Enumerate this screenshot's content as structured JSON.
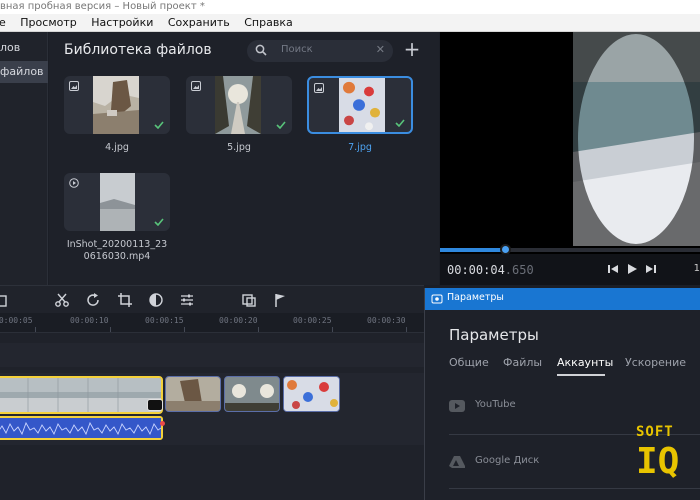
{
  "window": {
    "title": "вная пробная версия – Новый проект *"
  },
  "menu": {
    "items": [
      "е",
      "Просмотр",
      "Настройки",
      "Сохранить",
      "Справка"
    ],
    "underline_first": [
      "",
      "П",
      "Н",
      "С",
      "С"
    ]
  },
  "sidebar": {
    "items": [
      {
        "label": "лов",
        "active": false
      },
      {
        "label": "файлов",
        "active": true
      }
    ]
  },
  "library": {
    "title": "Библиотека файлов",
    "search_placeholder": "Поиск",
    "files": [
      {
        "name": "4.jpg",
        "type": "image-icon",
        "selected": false,
        "imported": true
      },
      {
        "name": "5.jpg",
        "type": "image-icon",
        "selected": false,
        "imported": true
      },
      {
        "name": "7.jpg",
        "type": "image-icon",
        "selected": true,
        "imported": true
      },
      {
        "name_line1": "InShot_20200113_23",
        "name_line2": "0616030.mp4",
        "type": "video-icon",
        "selected": false,
        "imported": true
      }
    ]
  },
  "player": {
    "time_main": "00:00:04",
    "time_ms": ".650",
    "volume_partial": "1",
    "progress": 0.25
  },
  "timeline": {
    "ruler": [
      "00:00:05",
      "00:00:10",
      "00:00:15",
      "00:00:20",
      "00:00:25",
      "00:00:30"
    ],
    "ruler_prefix": "0"
  },
  "settings_dialog": {
    "window_title": "Параметры",
    "heading": "Параметры",
    "tabs": [
      "Общие",
      "Файлы",
      "Аккаунты",
      "Ускорение"
    ],
    "active_tab": "Аккаунты",
    "accounts": [
      {
        "service": "YouTube",
        "icon": "youtube-icon"
      },
      {
        "service": "Google Диск",
        "icon": "google-drive-icon"
      }
    ]
  },
  "watermark": {
    "top": "SOFT",
    "bottom": "IQ"
  },
  "colors": {
    "accent": "#2f88de",
    "selection": "#3b8de0",
    "clip_border": "#f4d13a",
    "dialog_titlebar": "#1976d2",
    "watermark": "#e8c400"
  }
}
